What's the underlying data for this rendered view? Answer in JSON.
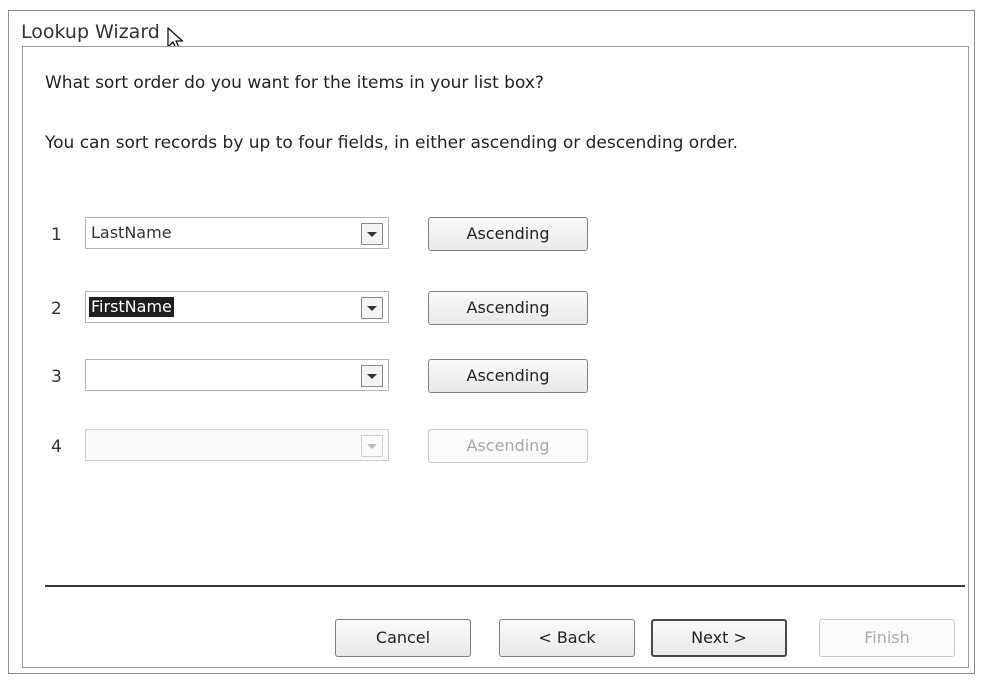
{
  "window": {
    "title": "Lookup Wizard"
  },
  "content": {
    "question": "What sort order do you want for the items in your list box?",
    "instruction": "You can sort records by up to four fields, in either ascending or descending order."
  },
  "sort_rows": [
    {
      "number": "1",
      "field": "LastName",
      "order": "Ascending",
      "enabled": true,
      "selected": false
    },
    {
      "number": "2",
      "field": "FirstName",
      "order": "Ascending",
      "enabled": true,
      "selected": true
    },
    {
      "number": "3",
      "field": "",
      "order": "Ascending",
      "enabled": true,
      "selected": false
    },
    {
      "number": "4",
      "field": "",
      "order": "Ascending",
      "enabled": false,
      "selected": false
    }
  ],
  "buttons": {
    "cancel": "Cancel",
    "back": "< Back",
    "next": "Next >",
    "finish": "Finish"
  },
  "icons": {
    "cursor": "mouse-pointer-icon",
    "dropdown": "chevron-down-icon"
  }
}
